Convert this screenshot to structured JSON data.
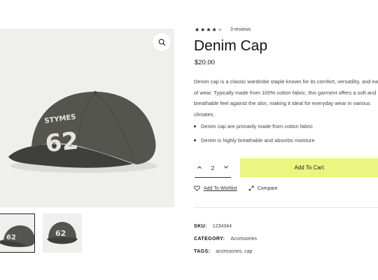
{
  "gallery": {
    "main_image": "denim-cap-photo",
    "cap_text": "STYMES",
    "cap_number": "62",
    "zoom_icon": "magnifier-icon",
    "thumbnails": [
      "denim-cap-side-thumb",
      "denim-cap-front-thumb"
    ]
  },
  "product": {
    "rating": 4,
    "rating_max": 5,
    "reviews_label": "3 reviews",
    "title": "Denim Cap",
    "price": "$20.00",
    "description": "Denim cap is a classic wardrobe staple known for its comfort, versatility, and ease of wear. Typically made from 100% cotton fabric, this garment offers a soft and breathable feel against the skin, making it ideal for everyday wear in various climates.",
    "bullets": [
      "Denim cap are primarily made from cotton fabric",
      "Denim is highly breathable and absorbs moisture"
    ]
  },
  "purchase": {
    "quantity": "2",
    "decrease_icon": "chevron-up-icon",
    "increase_icon": "chevron-down-icon",
    "add_to_cart_label": "Add To Cart",
    "accent_color": "#ebf680"
  },
  "actions": {
    "wishlist_label": "Add To Wishlist",
    "compare_label": "Compare"
  },
  "meta": {
    "sku_key": "SKU:",
    "sku_value": "1234344",
    "category_key": "CATEGORY:",
    "category_value": "Accessories",
    "tags_key": "TAGS:",
    "tags_value": "accessories, cap"
  }
}
